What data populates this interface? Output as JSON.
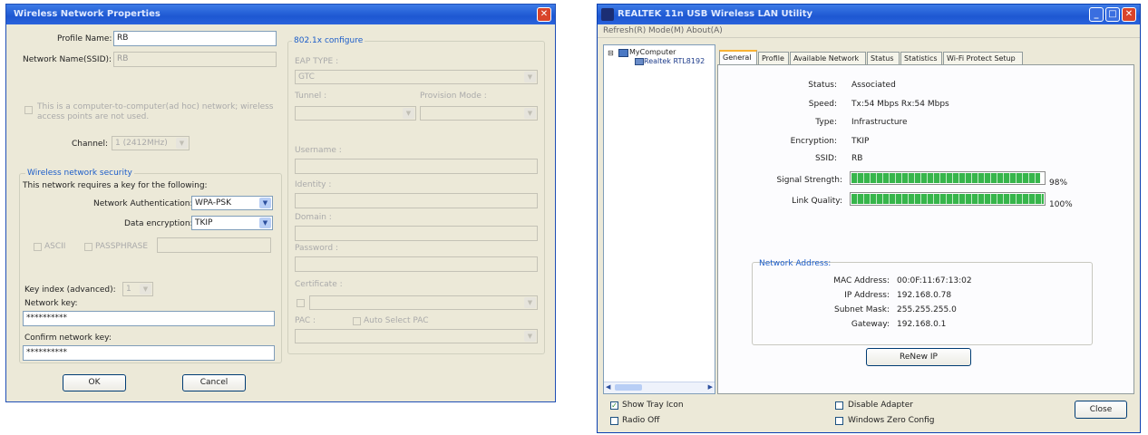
{
  "left_dialog": {
    "title": "Wireless Network Properties",
    "profile_name_label": "Profile Name:",
    "profile_name_value": "RB",
    "ssid_label": "Network Name(SSID):",
    "ssid_value": "RB",
    "adhoc_text_1": "This is a computer-to-computer(ad hoc) network; wireless",
    "adhoc_text_2": "access points are not used.",
    "channel_label": "Channel:",
    "channel_value": "1 (2412MHz)",
    "security_group_title": "Wireless network security",
    "security_intro": "This network requires a key for the following:",
    "auth_label": "Network Authentication:",
    "auth_value": "WPA-PSK",
    "enc_label": "Data encryption:",
    "enc_value": "TKIP",
    "ascii_label": "ASCII",
    "passphrase_label": "PASSPHRASE",
    "key_index_label": "Key index (advanced):",
    "key_index_value": "1",
    "network_key_label": "Network key:",
    "network_key_value": "**********",
    "confirm_key_label": "Confirm network key:",
    "confirm_key_value": "**********",
    "ok_label": "OK",
    "cancel_label": "Cancel",
    "dot1x_title": "802.1x configure",
    "eap_type_label": "EAP TYPE :",
    "eap_type_value": "GTC",
    "tunnel_label": "Tunnel :",
    "provision_label": "Provision Mode :",
    "username_label": "Username :",
    "identity_label": "Identity :",
    "domain_label": "Domain :",
    "password_label": "Password :",
    "certificate_label": "Certificate :",
    "pac_label": "PAC :",
    "auto_pac_label": "Auto Select PAC"
  },
  "right_window": {
    "title": "REALTEK 11n USB Wireless LAN Utility",
    "menu": [
      "Refresh(R)",
      "Mode(M)",
      "About(A)"
    ],
    "tree_root": "MyComputer",
    "tree_child": "Realtek RTL8192",
    "tabs": [
      "General",
      "Profile",
      "Available Network",
      "Status",
      "Statistics",
      "Wi-Fi Protect Setup"
    ],
    "status_label": "Status:",
    "status_value": "Associated",
    "speed_label": "Speed:",
    "speed_value": "Tx:54 Mbps Rx:54 Mbps",
    "type_label": "Type:",
    "type_value": "Infrastructure",
    "encryption_label": "Encryption:",
    "encryption_value": "TKIP",
    "ssid_label": "SSID:",
    "ssid_value": "RB",
    "signal_label": "Signal Strength:",
    "signal_value": "98%",
    "signal_percent": 98,
    "link_label": "Link Quality:",
    "link_value": "100%",
    "link_percent": 100,
    "netaddr_title": "Network Address:",
    "mac_label": "MAC Address:",
    "mac_value": "00:0F:11:67:13:02",
    "ip_label": "IP Address:",
    "ip_value": "192.168.0.78",
    "mask_label": "Subnet Mask:",
    "mask_value": "255.255.255.0",
    "gateway_label": "Gateway:",
    "gateway_value": "192.168.0.1",
    "renew_label": "ReNew IP",
    "show_tray_label": "Show Tray Icon",
    "radio_off_label": "Radio Off",
    "disable_adapter_label": "Disable Adapter",
    "wzc_label": "Windows Zero Config",
    "close_label": "Close"
  },
  "colors": {
    "title_blue": "#1d57d2",
    "close_red": "#d9442a",
    "bar_green": "#37b54b",
    "group_title": "#1c5dc9"
  }
}
